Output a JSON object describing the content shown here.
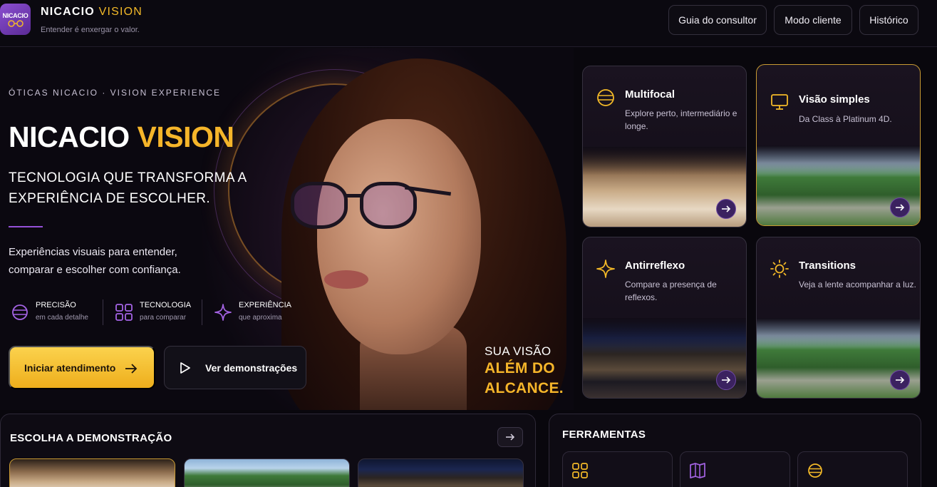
{
  "app": {
    "logo_text": "NICACIO",
    "brand": "NICACIO",
    "brand_accent": "VISION",
    "tagline": "Entender é enxergar o valor."
  },
  "nav": {
    "consultant_guide": "Guia do consultor",
    "client_mode": "Modo cliente",
    "history": "Histórico"
  },
  "hero": {
    "eyebrow": "ÓTICAS NICACIO · VISION EXPERIENCE",
    "title": "NICACIO",
    "title_accent": "VISION",
    "subtitle": "TECNOLOGIA QUE TRANSFORMA A EXPERIÊNCIA DE ESCOLHER.",
    "description": "Experiências visuais para entender, comparar e escolher com confiança.",
    "features": [
      {
        "title": "PRECISÃO",
        "sub": "em cada detalhe",
        "icon": "lens-icon"
      },
      {
        "title": "TECNOLOGIA",
        "sub": "para comparar",
        "icon": "grid-icon"
      },
      {
        "title": "EXPERIÊNCIA",
        "sub": "que aproxima",
        "icon": "sparkle-icon"
      }
    ],
    "primary_button": "Iniciar atendimento",
    "secondary_button": "Ver demonstrações",
    "slogan_line1": "SUA VISÃO",
    "slogan_line2": "ALÉM DO",
    "slogan_line3": "ALCANCE."
  },
  "demos": [
    {
      "title": "Multifocal",
      "desc": "Explore perto, intermediário e longe.",
      "icon": "lens-icon",
      "selected": false
    },
    {
      "title": "Visão simples",
      "desc": "Da Class à Platinum 4D.",
      "icon": "monitor-icon",
      "selected": true
    },
    {
      "title": "Antirreflexo",
      "desc": "Compare a presença de reflexos.",
      "icon": "sparkle-icon",
      "selected": false
    },
    {
      "title": "Transitions",
      "desc": "Veja a lente acompanhar a luz.",
      "icon": "sun-icon",
      "selected": false
    }
  ],
  "demo_panel": {
    "title": "ESCOLHA A DEMONSTRAÇÃO"
  },
  "tools_panel": {
    "title": "FERRAMENTAS",
    "tools": [
      "grid-icon",
      "book-icon",
      "lens-icon"
    ]
  },
  "colors": {
    "accent": "#f5b52a",
    "purple": "#9550d8",
    "background": "#09070d"
  }
}
